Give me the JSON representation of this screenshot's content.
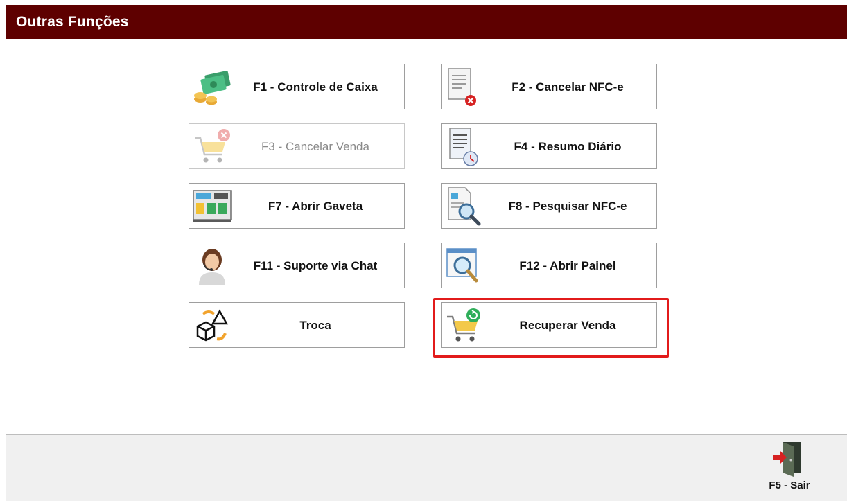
{
  "window": {
    "title": "Outras Funções"
  },
  "buttons": [
    {
      "label": "F1 - Controle de Caixa",
      "icon": "cash-money-icon"
    },
    {
      "label": "F2 - Cancelar NFC-e",
      "icon": "document-cancel-icon"
    },
    {
      "label": "F3 - Cancelar Venda",
      "icon": "cart-cancel-icon",
      "enabled": false
    },
    {
      "label": "F4 - Resumo Diário",
      "icon": "daily-report-clock-icon"
    },
    {
      "label": "F7 - Abrir Gaveta",
      "icon": "cash-drawer-icon"
    },
    {
      "label": "F8 - Pesquisar NFC-e",
      "icon": "document-search-icon"
    },
    {
      "label": "F11 - Suporte via Chat",
      "icon": "support-agent-icon"
    },
    {
      "label": "F12 - Abrir Painel",
      "icon": "panel-search-icon"
    },
    {
      "label": "Troca",
      "icon": "exchange-shapes-icon"
    },
    {
      "label": "Recuperar Venda",
      "icon": "cart-recover-icon",
      "highlighted": true
    }
  ],
  "footer": {
    "exit_label": "F5 - Sair",
    "exit_icon": "exit-door-icon"
  },
  "colors": {
    "titlebar": "#5e0000",
    "highlight": "#e21b1b"
  }
}
